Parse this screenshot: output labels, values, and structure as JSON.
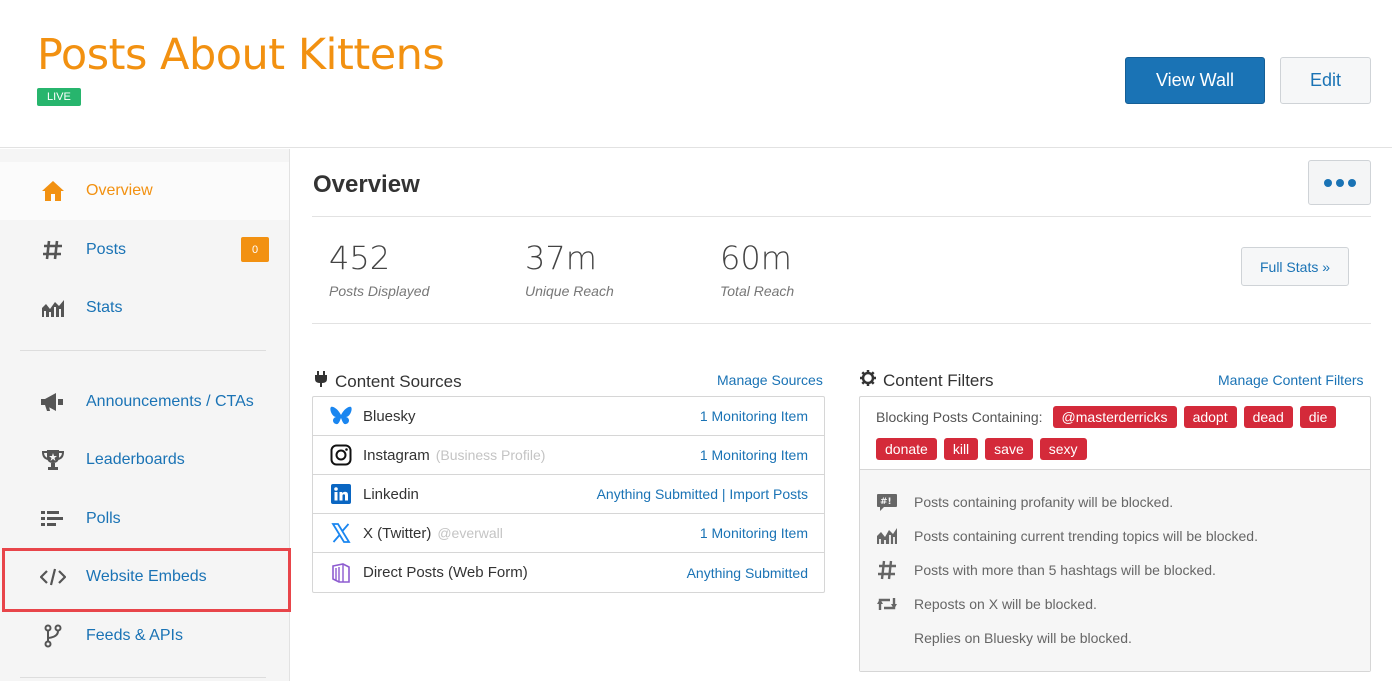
{
  "header": {
    "title": "Posts About Kittens",
    "status_badge": "LIVE",
    "view_wall_label": "View Wall",
    "edit_label": "Edit"
  },
  "sidebar": {
    "items": [
      {
        "label": "Overview",
        "icon": "home-icon",
        "active": true
      },
      {
        "label": "Posts",
        "icon": "hashtag-icon",
        "badge": "0"
      },
      {
        "label": "Stats",
        "icon": "chart-icon"
      },
      {
        "label": "Announcements / CTAs",
        "icon": "megaphone-icon"
      },
      {
        "label": "Leaderboards",
        "icon": "trophy-icon"
      },
      {
        "label": "Polls",
        "icon": "list-icon"
      },
      {
        "label": "Website Embeds",
        "icon": "code-icon",
        "highlighted": true
      },
      {
        "label": "Feeds & APIs",
        "icon": "fork-icon"
      }
    ]
  },
  "main": {
    "title": "Overview",
    "stats": [
      {
        "value": "452",
        "caption": "Posts Displayed"
      },
      {
        "value": "37m",
        "caption": "Unique Reach"
      },
      {
        "value": "60m",
        "caption": "Total Reach"
      }
    ],
    "full_stats_label": "Full Stats »",
    "content_sources": {
      "heading": "Content Sources",
      "manage_label": "Manage Sources",
      "rows": [
        {
          "name": "Bluesky",
          "sub": "",
          "link": "1 Monitoring Item",
          "icon": "bluesky-icon"
        },
        {
          "name": "Instagram",
          "sub": "(Business Profile)",
          "link": "1 Monitoring Item",
          "icon": "instagram-icon"
        },
        {
          "name": "Linkedin",
          "sub": "",
          "link": "Anything Submitted | Import Posts",
          "icon": "linkedin-icon"
        },
        {
          "name": "X (Twitter)",
          "sub": "@everwall",
          "link": "1 Monitoring Item",
          "icon": "x-twitter-icon"
        },
        {
          "name": "Direct Posts (Web Form)",
          "sub": "",
          "link": "Anything Submitted",
          "icon": "web-form-icon"
        }
      ]
    },
    "content_filters": {
      "heading": "Content Filters",
      "manage_label": "Manage Content Filters",
      "blocking_label": "Blocking Posts Containing:",
      "tags": [
        "@masterderricks",
        "adopt",
        "dead",
        "die",
        "donate",
        "kill",
        "save",
        "sexy"
      ],
      "rules": [
        {
          "icon": "profanity-icon",
          "text": "Posts containing profanity will be blocked."
        },
        {
          "icon": "trending-icon",
          "text": "Posts containing current trending topics will be blocked."
        },
        {
          "icon": "hashtag-icon",
          "text": "Posts with more than 5 hashtags will be blocked."
        },
        {
          "icon": "repost-icon",
          "text": "Reposts on X will be blocked."
        },
        {
          "icon": "",
          "text": "Replies on Bluesky will be blocked."
        }
      ]
    }
  },
  "colors": {
    "brand_orange": "#f29111",
    "link_blue": "#1a73b5",
    "live_green": "#27b56d",
    "tag_red": "#d42a3a",
    "highlight_red": "#e8454a"
  }
}
